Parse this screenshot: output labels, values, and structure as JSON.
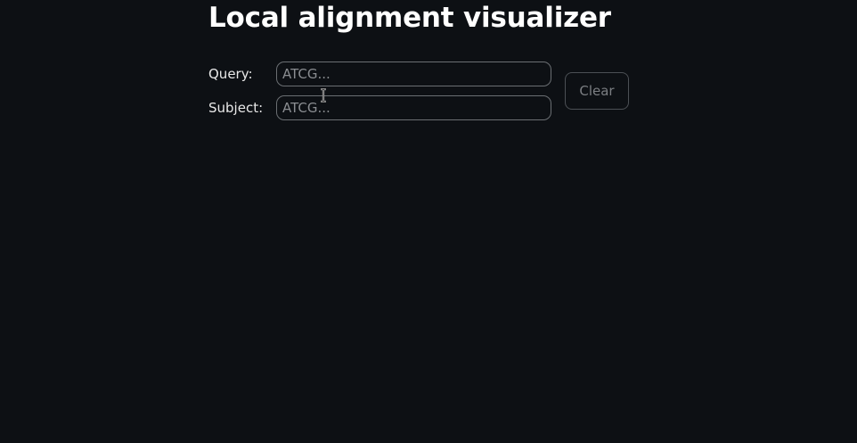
{
  "page": {
    "title": "Local alignment visualizer"
  },
  "form": {
    "query_label": "Query:",
    "query_placeholder": "ATCG...",
    "query_value": "",
    "subject_label": "Subject:",
    "subject_placeholder": "ATCG...",
    "subject_value": "",
    "clear_label": "Clear"
  },
  "icons": {
    "cursor": "text-cursor-icon"
  },
  "colors": {
    "background": "#0d1014",
    "input_border": "#6b6f73",
    "button_border": "#4c5055",
    "button_text": "#7b7e82"
  }
}
